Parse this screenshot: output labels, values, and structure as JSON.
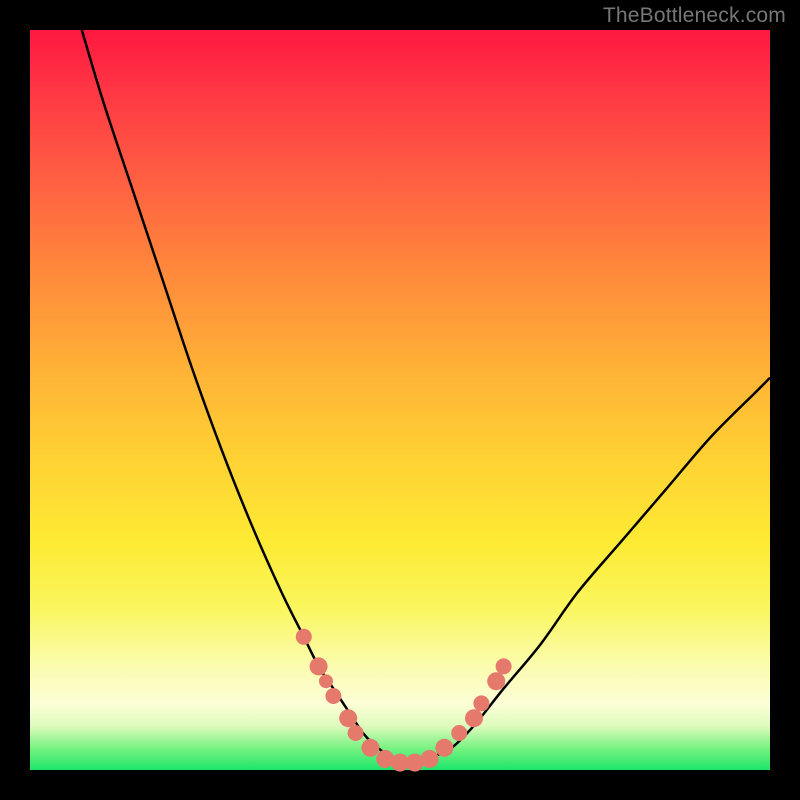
{
  "watermark": "TheBottleneck.com",
  "chart_data": {
    "type": "line",
    "title": "",
    "xlabel": "",
    "ylabel": "",
    "xlim": [
      0,
      100
    ],
    "ylim": [
      0,
      100
    ],
    "grid": false,
    "legend": false,
    "series": [
      {
        "name": "bottleneck-curve",
        "x": [
          7,
          10,
          14,
          18,
          22,
          26,
          30,
          34,
          37,
          39,
          41,
          43,
          45,
          47,
          50,
          53,
          55,
          57,
          60,
          64,
          69,
          74,
          80,
          86,
          92,
          98,
          100
        ],
        "y": [
          100,
          90,
          78,
          66,
          54,
          43,
          33,
          24,
          18,
          14,
          11,
          8,
          5,
          3,
          1,
          1,
          2,
          3,
          6,
          11,
          17,
          24,
          31,
          38,
          45,
          51,
          53
        ]
      }
    ],
    "markers": {
      "name": "highlighted-points",
      "x": [
        37,
        39,
        40,
        41,
        43,
        44,
        46,
        48,
        50,
        52,
        54,
        56,
        58,
        60,
        61,
        63,
        64
      ],
      "y": [
        18,
        14,
        12,
        10,
        7,
        5,
        3,
        1.5,
        1,
        1,
        1.5,
        3,
        5,
        7,
        9,
        12,
        14
      ],
      "r": [
        8,
        9,
        7,
        8,
        9,
        8,
        9,
        9,
        9,
        9,
        9,
        9,
        8,
        9,
        8,
        9,
        8
      ]
    }
  }
}
